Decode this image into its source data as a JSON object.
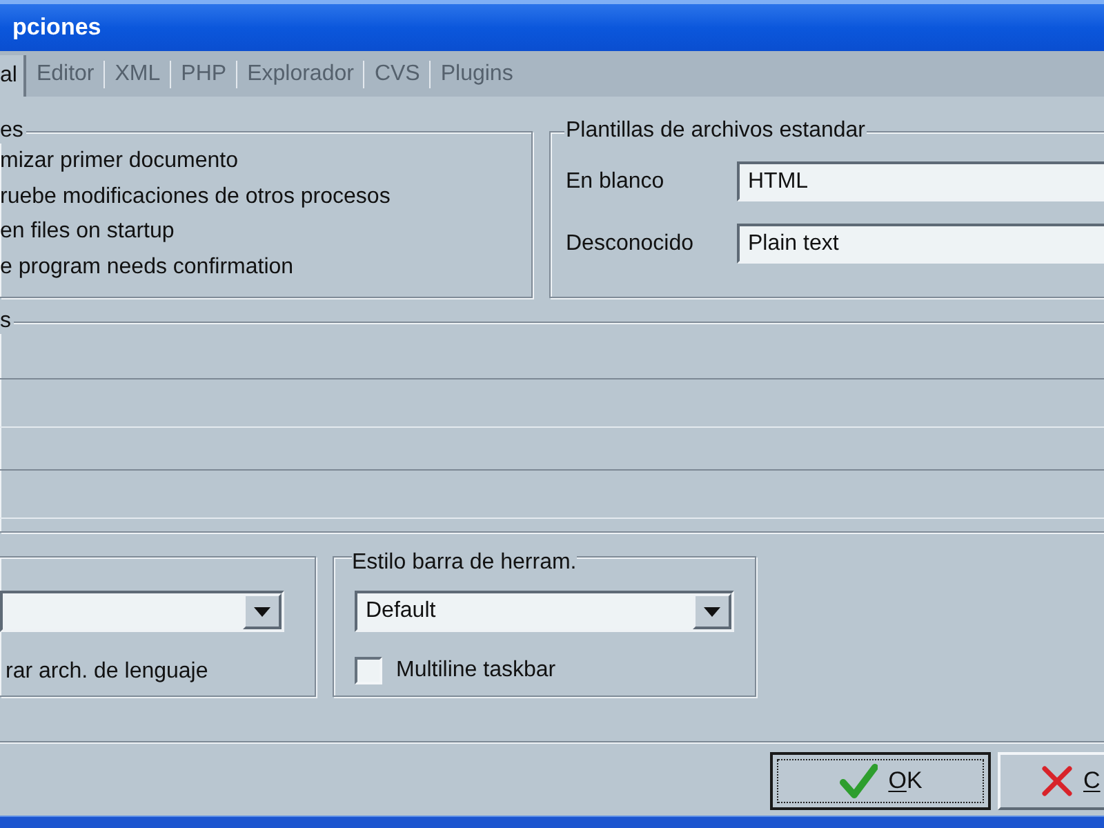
{
  "window": {
    "title": "pciones"
  },
  "tabs": [
    {
      "label": "al",
      "selected": true
    },
    {
      "label": "Editor",
      "selected": false
    },
    {
      "label": "XML",
      "selected": false
    },
    {
      "label": "PHP",
      "selected": false
    },
    {
      "label": "Explorador",
      "selected": false
    },
    {
      "label": "CVS",
      "selected": false
    },
    {
      "label": "Plugins",
      "selected": false
    }
  ],
  "general_group": {
    "legend": "es",
    "options": [
      "mizar primer documento",
      "ruebe modificaciones de otros procesos",
      "en files on startup",
      "e program needs confirmation"
    ]
  },
  "templates_group": {
    "legend": "Plantillas de archivos estandar",
    "fields": [
      {
        "label": "En blanco",
        "value": "HTML"
      },
      {
        "label": "Desconocido",
        "value": "Plain text"
      }
    ]
  },
  "middle_group": {
    "legend": "s"
  },
  "language_group": {
    "option": "rar arch. de lenguaje"
  },
  "toolbar_style_group": {
    "legend": "Estilo barra de herram.",
    "dropdown": {
      "value": "Default"
    },
    "checkbox": {
      "label": "Multiline taskbar",
      "checked": false
    }
  },
  "buttons": [
    {
      "label": "OK",
      "kind": "ok",
      "default": true,
      "mnemonic": true
    },
    {
      "label": "C",
      "kind": "cancel",
      "default": false,
      "mnemonic": true
    }
  ]
}
